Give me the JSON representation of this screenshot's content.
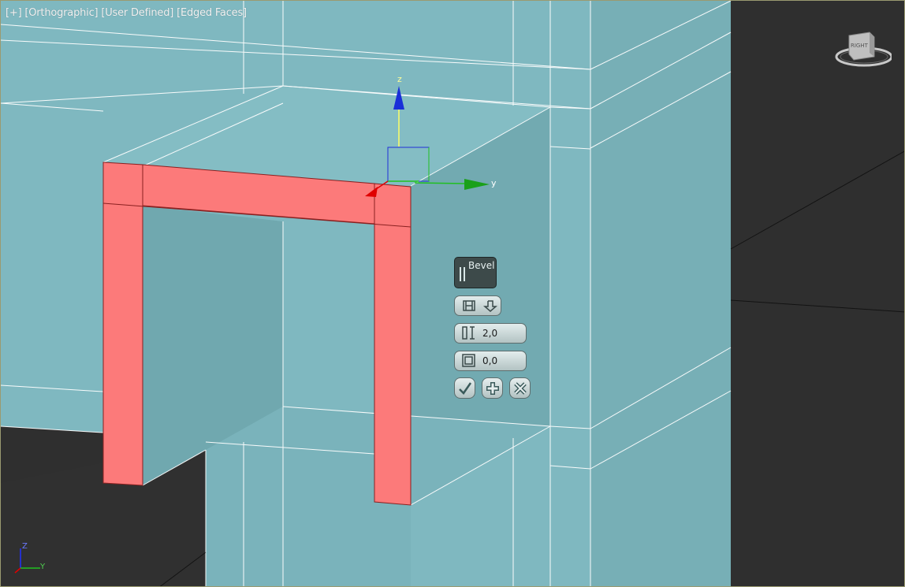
{
  "viewport": {
    "labels": [
      "[+]",
      "[Orthographic]",
      "[User Defined]",
      "[Edged Faces]"
    ]
  },
  "gizmo": {
    "z_label": "z",
    "y_label": "y"
  },
  "axis_tripod": {
    "z_label": "Z",
    "y_label": "Y"
  },
  "navcube": {
    "face_label": "RIGHT"
  },
  "bevel_caddy": {
    "title": "Bevel",
    "height_value": "2,0",
    "outline_value": "0,0"
  },
  "colors": {
    "mesh_face": "#7fb8c0",
    "mesh_face_dark": "#70a8af",
    "selected_face": "#fc7a7a",
    "edge": "#ffffff",
    "background": "#2f2f2f"
  }
}
